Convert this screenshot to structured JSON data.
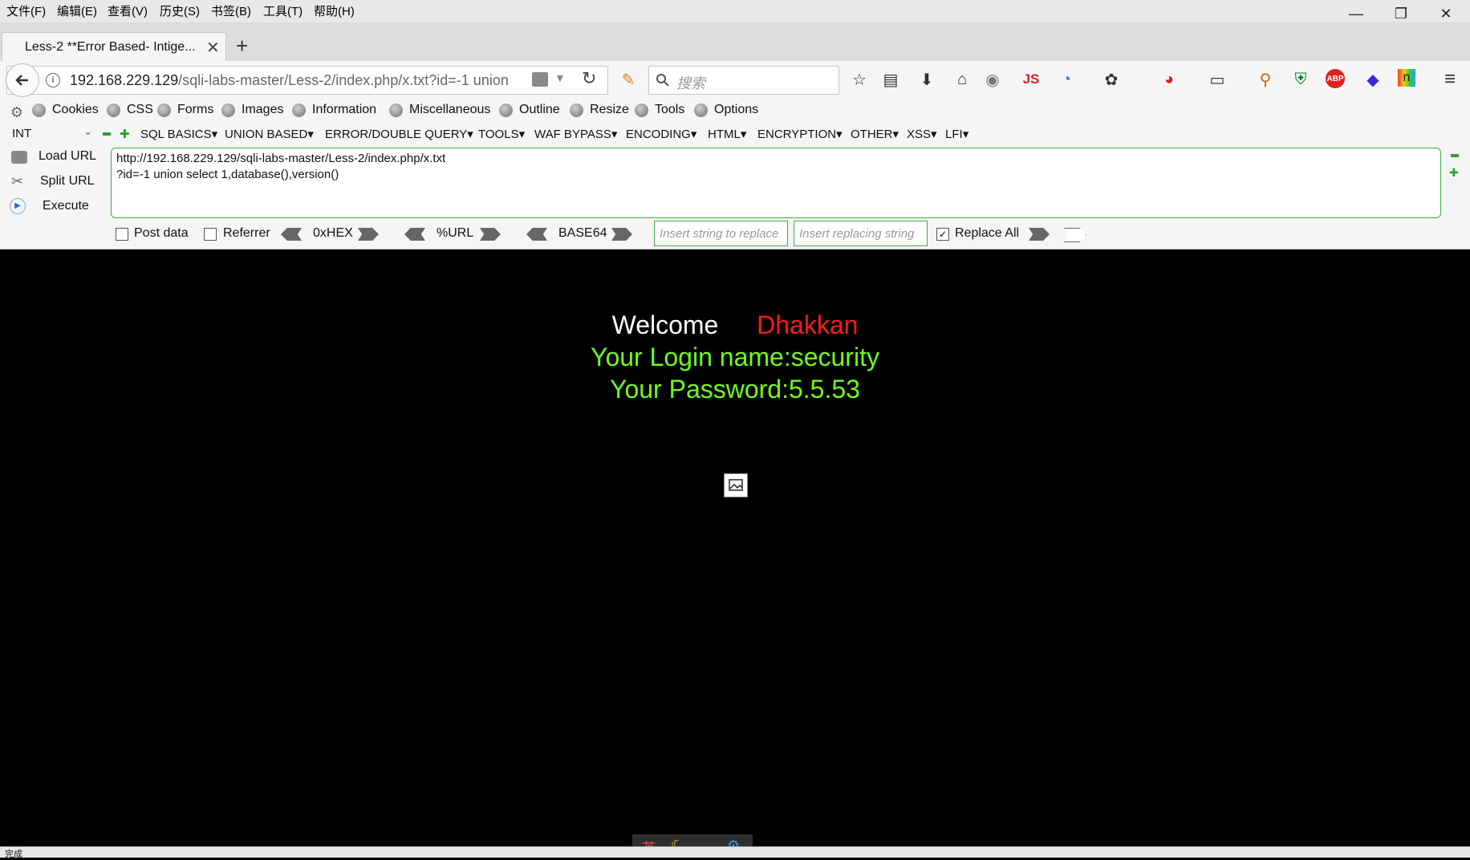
{
  "menu": {
    "items": [
      "文件(F)",
      "编辑(E)",
      "查看(V)",
      "历史(S)",
      "书签(B)",
      "工具(T)",
      "帮助(H)"
    ]
  },
  "window": {
    "minimize": "—",
    "restore": "❐",
    "close": "✕"
  },
  "tab": {
    "title": "Less-2 **Error Based- Intige...",
    "close": "✕",
    "new_tab": "+"
  },
  "nav": {
    "url_host": "192.168.229.129",
    "url_path": "/sqli-labs-master/Less-2/index.php/x.txt?id=-1 union",
    "search_placeholder": "搜索",
    "js_label": "JS",
    "abp_label": "ABP"
  },
  "webdev": {
    "items": [
      "Cookies",
      "CSS",
      "Forms",
      "Images",
      "Information",
      "Miscellaneous",
      "Outline",
      "Resize",
      "Tools",
      "Options"
    ]
  },
  "hackbar": {
    "type_select": "INT",
    "menus": [
      "SQL BASICS",
      "UNION BASED",
      "ERROR/DOUBLE QUERY",
      "TOOLS",
      "WAF BYPASS",
      "ENCODING",
      "HTML",
      "ENCRYPTION",
      "OTHER",
      "XSS",
      "LFI"
    ],
    "load_url": "Load URL",
    "split_url": "Split URL",
    "execute": "Execute",
    "text_line1": "http://192.168.229.129/sqli-labs-master/Less-2/index.php/x.txt",
    "text_line2": "?id=-1 union select 1,database(),version()",
    "post_data": "Post data",
    "referrer": "Referrer",
    "hex": "0xHEX",
    "url_enc": "%URL",
    "base64": "BASE64",
    "replace_placeholder": "Insert string to replace",
    "replacing_placeholder": "Insert replacing string",
    "replace_all": "Replace All"
  },
  "page": {
    "welcome": "Welcome",
    "name": "Dhakkan",
    "login_line": "Your Login name:security",
    "password_line": "Your Password:5.5.53"
  },
  "status": {
    "text": "完成",
    "ime_lang": "英"
  },
  "colors": {
    "welcome": "#ffffff",
    "name": "#ff0000",
    "result": "#66ff00",
    "hackbar_border": "#3fae3f"
  }
}
